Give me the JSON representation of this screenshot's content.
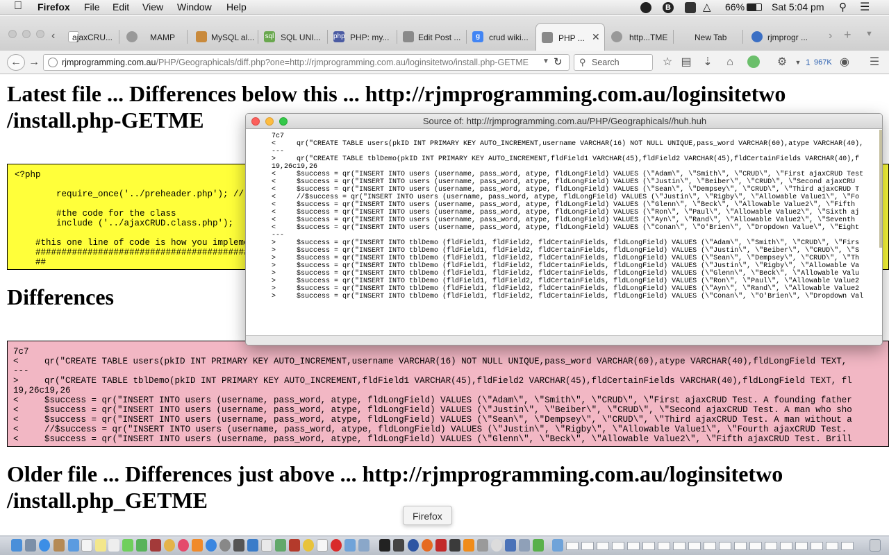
{
  "menubar": {
    "apple": "",
    "app_name": "Firefox",
    "menus": [
      "File",
      "Edit",
      "View",
      "Window",
      "Help"
    ],
    "battery": "66%",
    "clock": "Sat 5:04 pm"
  },
  "tabs": [
    {
      "label": "ajaxCRU...",
      "icon": "page-icon",
      "color": "#888"
    },
    {
      "label": "MAMP",
      "icon": "globe-icon",
      "color": "#777"
    },
    {
      "label": "MySQL al...",
      "icon": "edit-icon",
      "color": "#b07030"
    },
    {
      "label": "SQL UNI...",
      "icon": "sql-icon",
      "color": "#6aa84f"
    },
    {
      "label": "PHP: my...",
      "icon": "php-icon",
      "color": "#4b5ba3"
    },
    {
      "label": "Edit Post ...",
      "icon": "edit-icon",
      "color": "#666"
    },
    {
      "label": "crud wiki...",
      "icon": "google-icon",
      "color": "#4285f4"
    },
    {
      "label": "PHP ...",
      "icon": "edit-icon",
      "color": "#666",
      "active": true
    },
    {
      "label": "http...TME",
      "icon": "globe-icon",
      "color": "#777"
    },
    {
      "label": "New Tab",
      "icon": "",
      "color": ""
    },
    {
      "label": "rjmprogr ...",
      "icon": "swirl-icon",
      "color": "#3b6fc4"
    }
  ],
  "navbar": {
    "url_host": "rjmprogramming.com.au",
    "url_path": "/PHP/Geographicals/diff.php?one=http://rjmprogramming.com.au/loginsitetwo/install.php-GETME",
    "search_placeholder": "Search",
    "counter": "1",
    "counter_size": "967K"
  },
  "page": {
    "heading_latest": "Latest file ... Differences below this ... http://rjmprogramming.com.au/loginsitetwo",
    "heading_latest_2": "/install.php-GETME",
    "heading_differences": "Differences",
    "heading_older": "Older file ... Differences just above ... http://rjmprogramming.com.au/loginsitetwo",
    "heading_older_2": "/install.php_GETME",
    "yellow_lines": [
      "<?php",
      "",
      "        require_once('../preheader.php'); //",
      "",
      "        #the code for the class",
      "        include ('../ajaxCRUD.class.php');",
      "",
      "    #this one line of code is how you impleme",
      "    ##########################################",
      "    ##"
    ],
    "pink_lines": [
      "7c7",
      "<     qr(\"CREATE TABLE users(pkID INT PRIMARY KEY AUTO_INCREMENT,username VARCHAR(16) NOT NULL UNIQUE,pass_word VARCHAR(60),atype VARCHAR(40),fldLongField TEXT,",
      "---",
      ">     qr(\"CREATE TABLE tblDemo(pkID INT PRIMARY KEY AUTO_INCREMENT,fldField1 VARCHAR(45),fldField2 VARCHAR(45),fldCertainFields VARCHAR(40),fldLongField TEXT, fl",
      "19,26c19,26",
      "<     $success = qr(\"INSERT INTO users (username, pass_word, atype, fldLongField) VALUES (\\\"Adam\\\", \\\"Smith\\\", \\\"CRUD\\\", \\\"First ajaxCRUD Test. A founding father",
      "<     $success = qr(\"INSERT INTO users (username, pass_word, atype, fldLongField) VALUES (\\\"Justin\\\", \\\"Beiber\\\", \\\"CRUD\\\", \\\"Second ajaxCRUD Test. A man who sho",
      "<     $success = qr(\"INSERT INTO users (username, pass_word, atype, fldLongField) VALUES (\\\"Sean\\\", \\\"Dempsey\\\", \\\"CRUD\\\", \\\"Third ajaxCRUD Test. A man without a",
      "<     //$success = qr(\"INSERT INTO users (username, pass_word, atype, fldLongField) VALUES (\\\"Justin\\\", \\\"Rigby\\\", \\\"Allowable Value1\\\", \\\"Fourth ajaxCRUD Test. ",
      "<     $success = qr(\"INSERT INTO users (username, pass_word, atype, fldLongField) VALUES (\\\"Glenn\\\", \\\"Beck\\\", \\\"Allowable Value2\\\", \\\"Fifth ajaxCRUD Test. Brill"
    ]
  },
  "source_window": {
    "title": "Source of: http://rjmprogramming.com.au/PHP/Geographicals//huh.huh",
    "lines": [
      "7c7",
      "<     qr(\"CREATE TABLE users(pkID INT PRIMARY KEY AUTO_INCREMENT,username VARCHAR(16) NOT NULL UNIQUE,pass_word VARCHAR(60),atype VARCHAR(40),",
      "---",
      ">     qr(\"CREATE TABLE tblDemo(pkID INT PRIMARY KEY AUTO_INCREMENT,fldField1 VARCHAR(45),fldField2 VARCHAR(45),fldCertainFields VARCHAR(40),f",
      "19,26c19,26",
      "<     $success = qr(\"INSERT INTO users (username, pass_word, atype, fldLongField) VALUES (\\\"Adam\\\", \\\"Smith\\\", \\\"CRUD\\\", \\\"First ajaxCRUD Test",
      "<     $success = qr(\"INSERT INTO users (username, pass_word, atype, fldLongField) VALUES (\\\"Justin\\\", \\\"Beiber\\\", \\\"CRUD\\\", \\\"Second ajaxCRU",
      "<     $success = qr(\"INSERT INTO users (username, pass_word, atype, fldLongField) VALUES (\\\"Sean\\\", \\\"Dempsey\\\", \\\"CRUD\\\", \\\"Third ajaxCRUD T",
      "<     //$success = qr(\"INSERT INTO users (username, pass_word, atype, fldLongField) VALUES (\\\"Justin\\\", \\\"Rigby\\\", \\\"Allowable Value1\\\", \\\"Fo",
      "<     $success = qr(\"INSERT INTO users (username, pass_word, atype, fldLongField) VALUES (\\\"Glenn\\\", \\\"Beck\\\", \\\"Allowable Value2\\\", \\\"Fifth ",
      "<     $success = qr(\"INSERT INTO users (username, pass_word, atype, fldLongField) VALUES (\\\"Ron\\\", \\\"Paul\\\", \\\"Allowable Value2\\\", \\\"Sixth aj",
      "<     $success = qr(\"INSERT INTO users (username, pass_word, atype, fldLongField) VALUES (\\\"Ayn\\\", \\\"Rand\\\", \\\"Allowable Value2\\\", \\\"Seventh ",
      "<     $success = qr(\"INSERT INTO users (username, pass_word, atype, fldLongField) VALUES (\\\"Conan\\\", \\\"O'Brien\\\", \\\"Dropdown Value\\\", \\\"Eight",
      "---",
      ">     $success = qr(\"INSERT INTO tblDemo (fldField1, fldField2, fldCertainFields, fldLongField) VALUES (\\\"Adam\\\", \\\"Smith\\\", \\\"CRUD\\\", \\\"Firs",
      ">     $success = qr(\"INSERT INTO tblDemo (fldField1, fldField2, fldCertainFields, fldLongField) VALUES (\\\"Justin\\\", \\\"Beiber\\\", \\\"CRUD\\\", \\\"S",
      ">     $success = qr(\"INSERT INTO tblDemo (fldField1, fldField2, fldCertainFields, fldLongField) VALUES (\\\"Sean\\\", \\\"Dempsey\\\", \\\"CRUD\\\", \\\"Th",
      ">     $success = qr(\"INSERT INTO tblDemo (fldField1, fldField2, fldCertainFields, fldLongField) VALUES (\\\"Justin\\\", \\\"Rigby\\\", \\\"Allowable Va",
      ">     $success = qr(\"INSERT INTO tblDemo (fldField1, fldField2, fldCertainFields, fldLongField) VALUES (\\\"Glenn\\\", \\\"Beck\\\", \\\"Allowable Valu",
      ">     $success = qr(\"INSERT INTO tblDemo (fldField1, fldField2, fldCertainFields, fldLongField) VALUES (\\\"Ron\\\", \\\"Paul\\\", \\\"Allowable Value2",
      ">     $success = qr(\"INSERT INTO tblDemo (fldField1, fldField2, fldCertainFields, fldLongField) VALUES (\\\"Ayn\\\", \\\"Rand\\\", \\\"Allowable Value2",
      ">     $success = qr(\"INSERT INTO tblDemo (fldField1, fldField2, fldCertainFields, fldLongField) VALUES (\\\"Conan\\\", \\\"O'Brien\\\", \\\"Dropdown Val"
    ]
  },
  "tooltip": "Firefox",
  "colors": {
    "yellow_box": "#ffff3a",
    "pink_box": "#f2b7c4",
    "close_dot": "#fc605c",
    "min_dot": "#fdbc40",
    "max_dot": "#34c84a"
  }
}
